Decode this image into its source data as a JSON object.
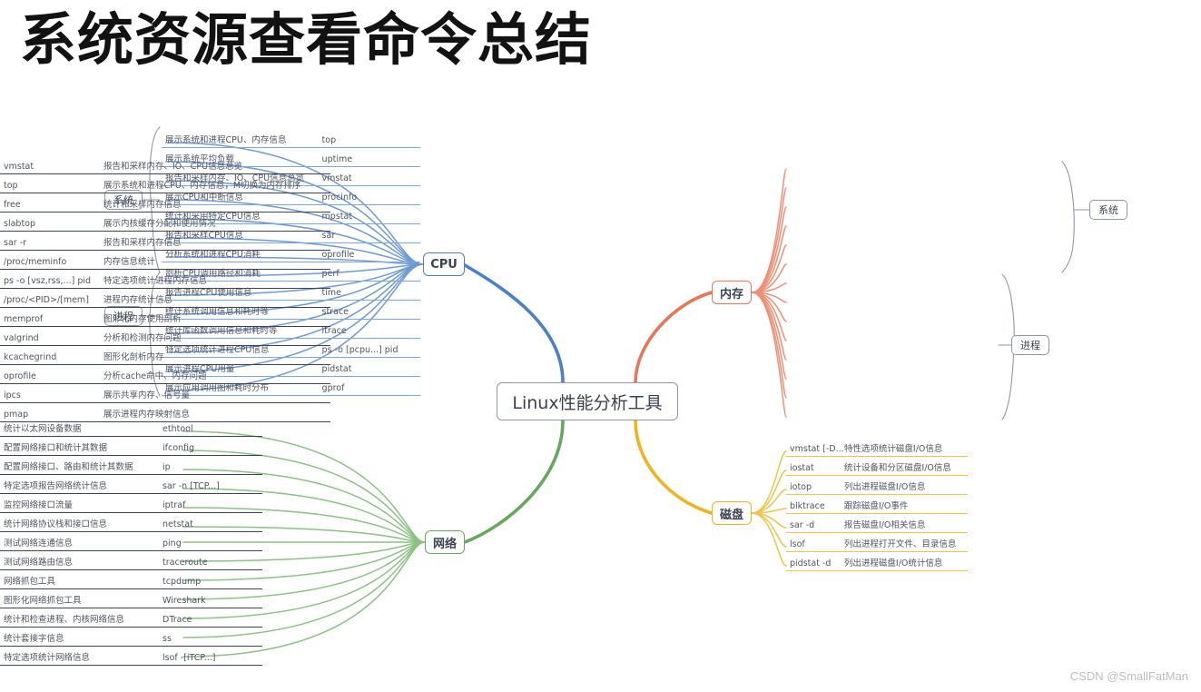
{
  "page": {
    "title": "系统资源查看命令总结",
    "watermark": "CSDN @SmallFatMan"
  },
  "mindmap": {
    "center": "Linux性能分析工具",
    "colors": {
      "cpu": "#4a80c8",
      "network": "#66a95e",
      "memory": "#e8765a",
      "disk": "#eeb31f",
      "center_border": "#8b97ab",
      "group_border": "#8b97ab",
      "text": "#4c5360",
      "title": "#121212",
      "watermark": "#b9bcc2"
    },
    "branches": [
      {
        "key": "cpu",
        "label": "CPU",
        "side": "left",
        "color": "#4a80c8",
        "groups": [
          {
            "label": "系统",
            "items": [
              {
                "desc": "展示系统和进程CPU、内存信息",
                "cmd": "top"
              },
              {
                "desc": "展示系统平均负载",
                "cmd": "uptime"
              },
              {
                "desc": "报告和采样内存、IO、CPU信息总览",
                "cmd": "vmstat"
              },
              {
                "desc": "展示CPU和中断信息",
                "cmd": "procinfo"
              },
              {
                "desc": "统计和采用特定CPU信息",
                "cmd": "mpstat"
              },
              {
                "desc": "报告和采样CPU信息",
                "cmd": "sar"
              },
              {
                "desc": "分析系统和进程CPU消耗",
                "cmd": "oprofile"
              },
              {
                "desc": "剖析CPU调用路径和消耗",
                "cmd": "perf"
              }
            ]
          },
          {
            "label": "进程",
            "items": [
              {
                "desc": "报告进程CPU使用信息",
                "cmd": "time"
              },
              {
                "desc": "统计系统调用信息和耗时等",
                "cmd": "strace"
              },
              {
                "desc": "统计库函数调用信息和耗时等",
                "cmd": "ltrace"
              },
              {
                "desc": "特定选项统计进程CPU信息",
                "cmd": "ps -o [pcpu...] pid"
              },
              {
                "desc": "展示进程CPU用量",
                "cmd": "pidstat"
              },
              {
                "desc": "展示应用调用图和耗时分布",
                "cmd": "gprof"
              }
            ]
          }
        ]
      },
      {
        "key": "network",
        "label": "网络",
        "side": "left",
        "color": "#66a95e",
        "groups": [
          {
            "label": "",
            "items": [
              {
                "desc": "统计以太网设备数据",
                "cmd": "ethtool"
              },
              {
                "desc": "配置网络接口和统计其数据",
                "cmd": "ifconfig"
              },
              {
                "desc": "配置网络接口、路由和统计其数据",
                "cmd": "ip"
              },
              {
                "desc": "特定选项报告网络统计信息",
                "cmd": "sar -n [TCP...]"
              },
              {
                "desc": "监控网络接口流量",
                "cmd": "iptraf"
              },
              {
                "desc": "统计网络协议栈和接口信息",
                "cmd": "netstat"
              },
              {
                "desc": "测试网络连通信息",
                "cmd": "ping"
              },
              {
                "desc": "测试网络路由信息",
                "cmd": "traceroute"
              },
              {
                "desc": "网络抓包工具",
                "cmd": "tcpdump"
              },
              {
                "desc": "图形化网络抓包工具",
                "cmd": "Wireshark"
              },
              {
                "desc": "统计和检查进程、内核网络信息",
                "cmd": "DTrace"
              },
              {
                "desc": "统计套接字信息",
                "cmd": "ss"
              },
              {
                "desc": "特定选项统计网络信息",
                "cmd": "lsof -[iTCP...]"
              }
            ]
          }
        ]
      },
      {
        "key": "memory",
        "label": "内存",
        "side": "right",
        "color": "#e8765a",
        "groups": [
          {
            "label": "系统",
            "items": [
              {
                "cmd": "vmstat",
                "desc": "报告和采样内存、IO、CPU信息总览"
              },
              {
                "cmd": "top",
                "desc": "展示系统和进程CPU、内存信息，M切换为内存排序"
              },
              {
                "cmd": "free",
                "desc": "统计和采样内存信息"
              },
              {
                "cmd": "slabtop",
                "desc": "展示内核缓存分配和使用情况"
              },
              {
                "cmd": "sar -r",
                "desc": "报告和采样内存信息"
              },
              {
                "cmd": "/proc/meminfo",
                "desc": "内存信息统计"
              }
            ]
          },
          {
            "label": "进程",
            "items": [
              {
                "cmd": "ps -o [vsz,rss,...] pid",
                "desc": "特定选项统计进程内存信息"
              },
              {
                "cmd": "/proc/<PID>/[mem]",
                "desc": "进程内存统计信息"
              },
              {
                "cmd": "memprof",
                "desc": "图形化内存使用剖析"
              },
              {
                "cmd": "valgrind",
                "desc": "分析和检测内存问题"
              },
              {
                "cmd": "kcachegrind",
                "desc": "图形化剖析内存"
              },
              {
                "cmd": "oprofile",
                "desc": "分析cache命中、内存问题"
              },
              {
                "cmd": "ipcs",
                "desc": "展示共享内存、信号量"
              },
              {
                "cmd": "pmap",
                "desc": "展示进程内存映射信息"
              }
            ]
          }
        ]
      },
      {
        "key": "disk",
        "label": "磁盘",
        "side": "right",
        "color": "#eeb31f",
        "groups": [
          {
            "label": "",
            "items": [
              {
                "cmd": "vmstat [-D...]",
                "desc": "特性选项统计磁盘I/O信息"
              },
              {
                "cmd": "iostat",
                "desc": "统计设备和分区磁盘I/O信息"
              },
              {
                "cmd": "iotop",
                "desc": "列出进程磁盘I/O信息"
              },
              {
                "cmd": "blktrace",
                "desc": "跟踪磁盘I/O事件"
              },
              {
                "cmd": "sar -d",
                "desc": "报告磁盘I/O相关信息"
              },
              {
                "cmd": "lsof",
                "desc": "列出进程打开文件、目录信息"
              },
              {
                "cmd": "pidstat -d",
                "desc": "列出进程磁盘I/O统计信息"
              }
            ]
          }
        ]
      }
    ],
    "group_chips": {
      "left_system": "系统",
      "left_process": "进程",
      "right_system": "系统",
      "right_process": "进程"
    }
  }
}
